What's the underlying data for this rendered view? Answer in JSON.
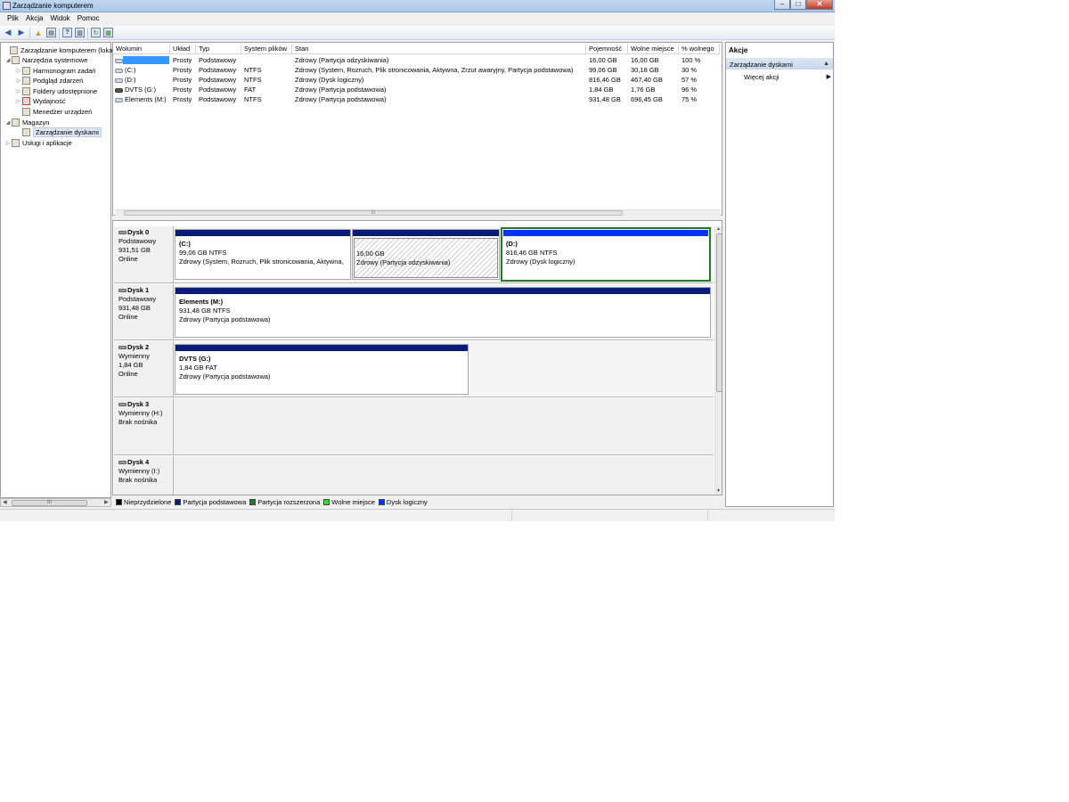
{
  "window": {
    "title": "Zarządzanie komputerem"
  },
  "menu": [
    "Plik",
    "Akcja",
    "Widok",
    "Pomoc"
  ],
  "tree": {
    "items": [
      {
        "label": "Zarządzanie komputerem (loka",
        "icon": "computer-icon",
        "twisty": ""
      },
      {
        "label": "Narzędzia systemowe",
        "icon": "tools-icon",
        "twisty": "◢"
      },
      {
        "label": "Harmonogram zadań",
        "icon": "clock-icon",
        "twisty": "▷"
      },
      {
        "label": "Podgląd zdarzeń",
        "icon": "event-viewer-icon",
        "twisty": "▷"
      },
      {
        "label": "Foldery udostępnione",
        "icon": "shared-folder-icon",
        "twisty": "▷"
      },
      {
        "label": "Wydajność",
        "icon": "performance-icon",
        "twisty": "▷"
      },
      {
        "label": "Menedżer urządzeń",
        "icon": "device-manager-icon",
        "twisty": ""
      },
      {
        "label": "Magazyn",
        "icon": "storage-icon",
        "twisty": "◢"
      },
      {
        "label": "Zarządzanie dyskami",
        "icon": "disk-management-icon",
        "twisty": ""
      },
      {
        "label": "Usługi i aplikacje",
        "icon": "services-icon",
        "twisty": "▷"
      }
    ],
    "scroll_thumb_label": "III"
  },
  "volumes": {
    "headers": [
      "Wolumin",
      "Układ",
      "Typ",
      "System plików",
      "Stan",
      "Pojemność",
      "Wolne miejsce",
      "% wolnego"
    ],
    "rows": [
      {
        "name": "",
        "layout": "Prosty",
        "type": "Podstawowy",
        "fs": "",
        "status": "Zdrowy (Partycja odzyskiwania)",
        "capacity": "16,00 GB",
        "free": "16,00 GB",
        "pct": "100 %"
      },
      {
        "name": "(C:)",
        "layout": "Prosty",
        "type": "Podstawowy",
        "fs": "NTFS",
        "status": "Zdrowy (System, Rozruch, Plik stronicowania, Aktywna, Zrzut awaryjny, Partycja podstawowa)",
        "capacity": "99,06 GB",
        "free": "30,18 GB",
        "pct": "30 %"
      },
      {
        "name": "(D:)",
        "layout": "Prosty",
        "type": "Podstawowy",
        "fs": "NTFS",
        "status": "Zdrowy (Dysk logiczny)",
        "capacity": "816,46 GB",
        "free": "467,40 GB",
        "pct": "57 %"
      },
      {
        "name": "DVTS (G:)",
        "layout": "Prosty",
        "type": "Podstawowy",
        "fs": "FAT",
        "status": "Zdrowy (Partycja podstawowa)",
        "capacity": "1,84 GB",
        "free": "1,76 GB",
        "pct": "96 %"
      },
      {
        "name": "Elements (M:)",
        "layout": "Prosty",
        "type": "Podstawowy",
        "fs": "NTFS",
        "status": "Zdrowy (Partycja podstawowa)",
        "capacity": "931,48 GB",
        "free": "696,45 GB",
        "pct": "75 %"
      }
    ]
  },
  "disks": [
    {
      "name": "Dysk 0",
      "type": "Podstawowy",
      "size": "931,51 GB",
      "state": "Online",
      "parts": [
        {
          "title": "(C:)",
          "size": "99,06 GB NTFS",
          "status": "Zdrowy (System, Rozruch, Plik stronicowania, Aktywna,"
        },
        {
          "title": "",
          "size": "16,00 GB",
          "status": "Zdrowy (Partycja odzyskiwania)"
        },
        {
          "title": "(D:)",
          "size": "816,46 GB NTFS",
          "status": "Zdrowy (Dysk logiczny)"
        }
      ]
    },
    {
      "name": "Dysk 1",
      "type": "Podstawowy",
      "size": "931,48 GB",
      "state": "Online",
      "parts": [
        {
          "title": "Elements  (M:)",
          "size": "931,48 GB NTFS",
          "status": "Zdrowy (Partycja podstawowa)"
        }
      ]
    },
    {
      "name": "Dysk 2",
      "type": "Wymienny",
      "size": "1,84 GB",
      "state": "Online",
      "parts": [
        {
          "title": "DVTS  (G:)",
          "size": "1,84 GB FAT",
          "status": "Zdrowy (Partycja podstawowa)"
        }
      ]
    },
    {
      "name": "Dysk 3",
      "type": "Wymienny (H:)",
      "size": "",
      "state": "Brak nośnika",
      "parts": []
    },
    {
      "name": "Dysk 4",
      "type": "Wymienny (I:)",
      "size": "",
      "state": "Brak nośnika",
      "parts": []
    }
  ],
  "legend": [
    {
      "label": "Nieprzydzielone",
      "color": "#000000"
    },
    {
      "label": "Partycja podstawowa",
      "color": "#0a1c7a"
    },
    {
      "label": "Partycja rozszerzona",
      "color": "#227a22"
    },
    {
      "label": "Wolne miejsce",
      "color": "#33dd33"
    },
    {
      "label": "Dysk logiczny",
      "color": "#0033ff"
    }
  ],
  "actions": {
    "title": "Akcje",
    "section": "Zarządzanie dyskami",
    "more": "Więcej akcji"
  }
}
